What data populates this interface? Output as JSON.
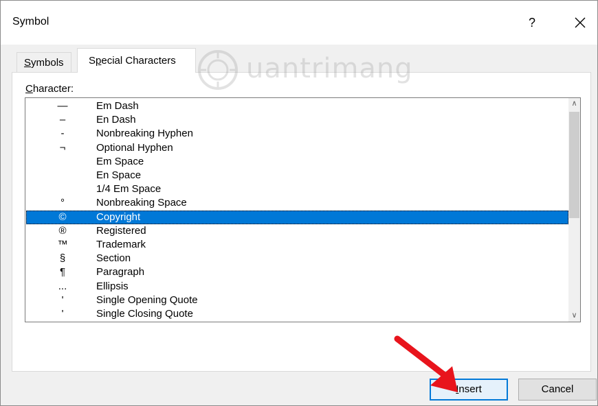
{
  "window": {
    "title": "Symbol",
    "help_label": "?",
    "close_icon": "close-icon"
  },
  "tabs": [
    {
      "label_prefix": "",
      "label_underlined": "S",
      "label_rest": "ymbols"
    },
    {
      "label_prefix": "S",
      "label_underlined": "p",
      "label_rest": "ecial Characters"
    }
  ],
  "panel": {
    "character_label_underlined": "C",
    "character_label_rest": "haracter:"
  },
  "characters": [
    {
      "char": "—",
      "name": "Em Dash"
    },
    {
      "char": "–",
      "name": "En Dash"
    },
    {
      "char": "-",
      "name": "Nonbreaking Hyphen"
    },
    {
      "char": "¬",
      "name": "Optional Hyphen"
    },
    {
      "char": "",
      "name": "Em Space"
    },
    {
      "char": "",
      "name": "En Space"
    },
    {
      "char": "",
      "name": "1/4 Em Space"
    },
    {
      "char": "°",
      "name": "Nonbreaking Space"
    },
    {
      "char": "©",
      "name": "Copyright"
    },
    {
      "char": "®",
      "name": "Registered"
    },
    {
      "char": "™",
      "name": "Trademark"
    },
    {
      "char": "§",
      "name": "Section"
    },
    {
      "char": "¶",
      "name": "Paragraph"
    },
    {
      "char": "...",
      "name": "Ellipsis"
    },
    {
      "char": "'",
      "name": "Single Opening Quote"
    },
    {
      "char": "'",
      "name": "Single Closing Quote"
    }
  ],
  "selected_index": 8,
  "buttons": {
    "insert_underlined": "I",
    "insert_rest": "nsert",
    "cancel": "Cancel"
  },
  "watermark": {
    "text": "uantrimang"
  },
  "colors": {
    "selection": "#0078d7",
    "arrow": "#e8141c"
  }
}
